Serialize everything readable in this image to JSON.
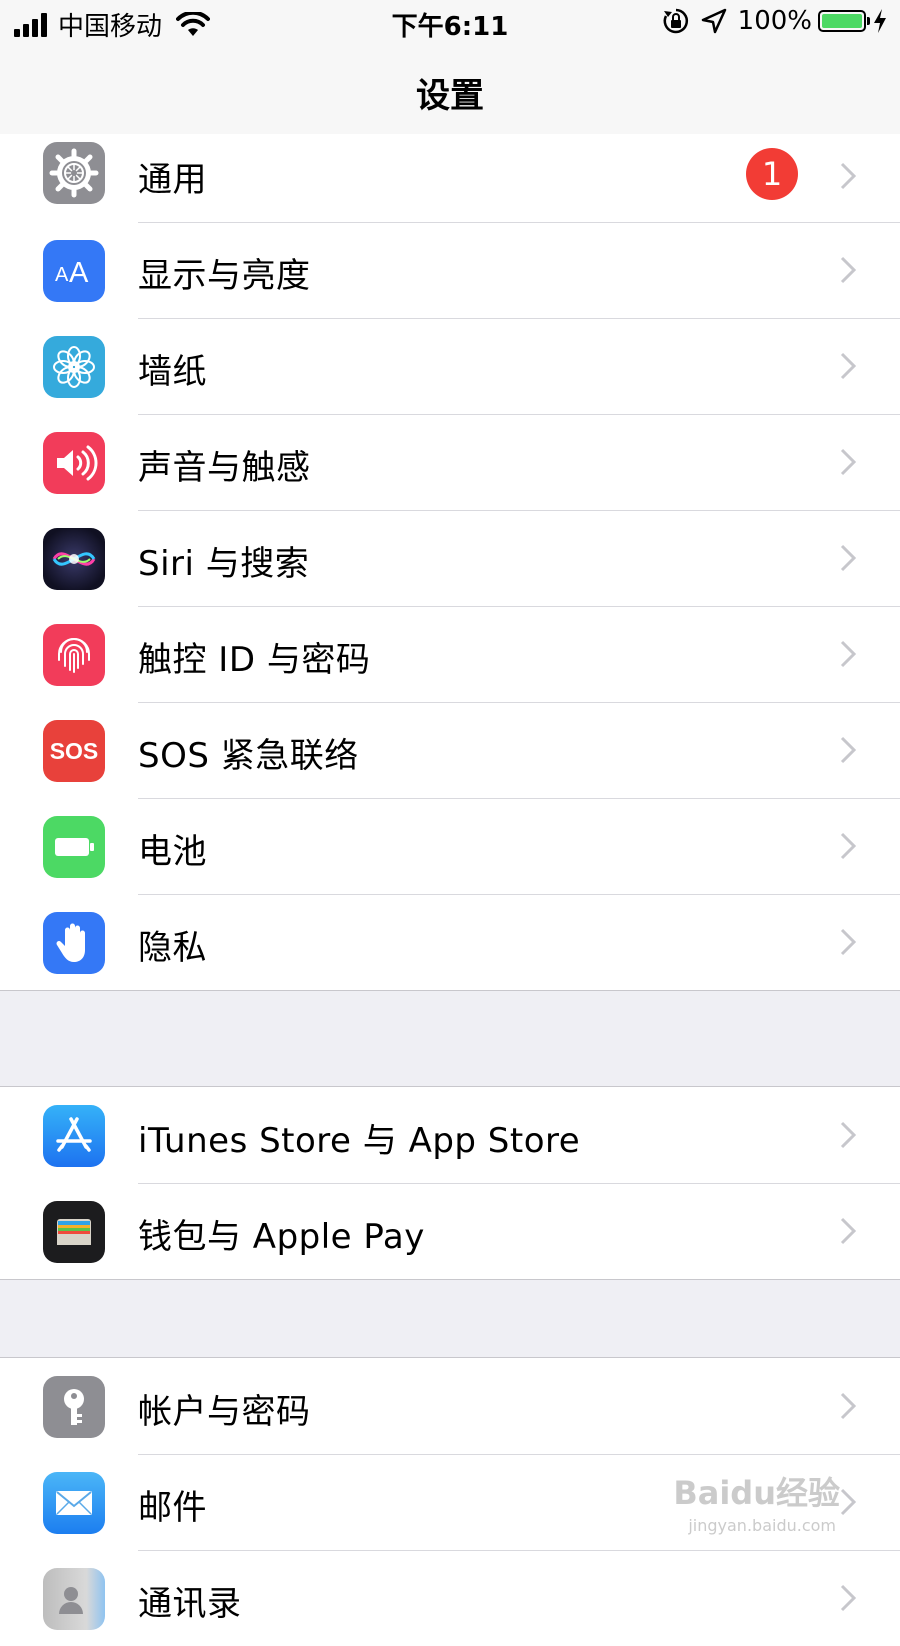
{
  "status_bar": {
    "carrier": "中国移动",
    "time": "下午6:11",
    "battery_percent_text": "100%",
    "battery_level": 1.0,
    "icons": [
      "signal-icon",
      "wifi-icon",
      "rotation-lock-icon",
      "location-icon",
      "battery-icon",
      "charging-icon"
    ]
  },
  "nav": {
    "title": "设置"
  },
  "groups": [
    {
      "items": [
        {
          "label": "通用",
          "icon": "gear-icon",
          "color": "#8e8e93",
          "badge": "1"
        },
        {
          "label": "显示与亮度",
          "icon": "text-size-icon",
          "color": "#3478f6"
        },
        {
          "label": "墙纸",
          "icon": "flower-icon",
          "color": "#35aadc"
        },
        {
          "label": "声音与触感",
          "icon": "speaker-icon",
          "color": "#f23c5a"
        },
        {
          "label": "Siri 与搜索",
          "icon": "siri-icon",
          "color": "#1c1c3a"
        },
        {
          "label": "触控 ID 与密码",
          "icon": "fingerprint-icon",
          "color": "#f23c5a"
        },
        {
          "label": "SOS 紧急联络",
          "icon": "sos-icon",
          "color": "#e8413b",
          "icon_text": "SOS"
        },
        {
          "label": "电池",
          "icon": "battery-app-icon",
          "color": "#4cd964"
        },
        {
          "label": "隐私",
          "icon": "hand-icon",
          "color": "#3478f6"
        }
      ]
    },
    {
      "items": [
        {
          "label": "iTunes Store 与 App Store",
          "icon": "app-store-icon",
          "color": "#2f8ef5"
        },
        {
          "label": "钱包与 Apple Pay",
          "icon": "wallet-icon",
          "color": "#1c1c1e"
        }
      ]
    },
    {
      "items": [
        {
          "label": "帐户与密码",
          "icon": "key-icon",
          "color": "#8e8e93"
        },
        {
          "label": "邮件",
          "icon": "mail-icon",
          "color": "#3b9af5"
        },
        {
          "label": "通讯录",
          "icon": "contacts-icon",
          "color": "#c9c9c9"
        }
      ]
    }
  ],
  "watermark": {
    "text": "Baidu经验",
    "url": "jingyan.baidu.com"
  }
}
